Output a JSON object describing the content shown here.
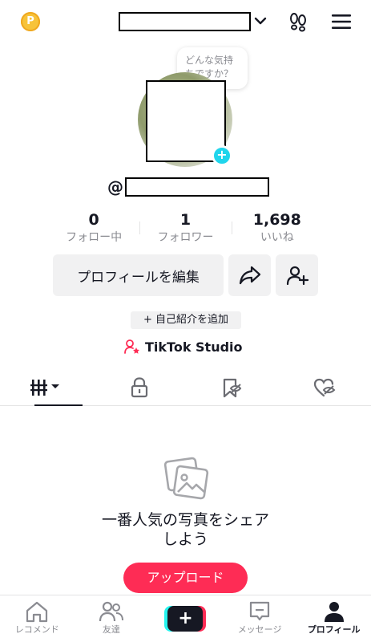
{
  "header": {
    "coin_icon": "coin-icon",
    "coin_glyph": "P",
    "menu_icon": "hamburger-icon"
  },
  "bubble": {
    "text": "どんな気持ちですか？"
  },
  "profile": {
    "at_sign": "@",
    "stats": [
      {
        "value": "0",
        "label": "フォロー中"
      },
      {
        "value": "1",
        "label": "フォロワー"
      },
      {
        "value": "1,698",
        "label": "いいね"
      }
    ],
    "edit_label": "プロフィールを編集",
    "bio_add_label": "+ 自己紹介を追加",
    "studio_label": "TikTok Studio"
  },
  "tabs": [
    "videos",
    "private",
    "reposts",
    "liked"
  ],
  "empty_state": {
    "title_line1": "一番人気の写真をシェア",
    "title_line2": "しよう",
    "upload_label": "アップロード"
  },
  "bottom_nav": [
    {
      "label": "レコメンド"
    },
    {
      "label": "友達"
    },
    {
      "label": ""
    },
    {
      "label": "メッセージ"
    },
    {
      "label": "プロフィール"
    }
  ],
  "colors": {
    "accent": "#fe2c55",
    "cyan": "#25f4ee",
    "text": "#161823",
    "muted": "#8a8b91"
  }
}
